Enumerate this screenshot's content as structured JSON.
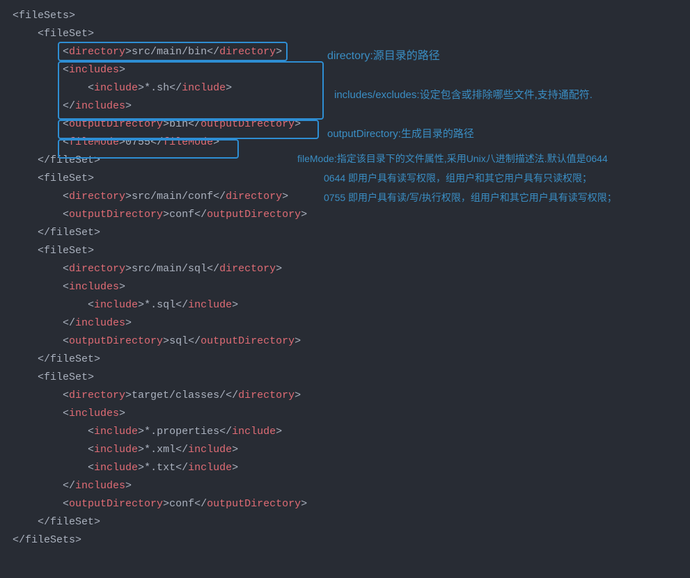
{
  "code": {
    "l1": "<fileSets>",
    "l2": "    <fileSet>",
    "l3a": "        <",
    "l3t1": "directory",
    "l3b": ">",
    "l3txt": "src/main/bin",
    "l3c": "</",
    "l3t2": "directory",
    "l3d": ">",
    "l4a": "        <",
    "l4t1": "includes",
    "l4b": ">",
    "l5a": "            <",
    "l5t1": "include",
    "l5b": ">",
    "l5txt": "*.sh",
    "l5c": "</",
    "l5t2": "include",
    "l5d": ">",
    "l6a": "        </",
    "l6t1": "includes",
    "l6b": ">",
    "l7a": "        <",
    "l7t1": "outputDirectory",
    "l7b": ">",
    "l7txt": "bin",
    "l7c": "</",
    "l7t2": "outputDirectory",
    "l7d": ">",
    "l8a": "        <",
    "l8t1": "fileMode",
    "l8b": ">",
    "l8txt": "0755",
    "l8c": "</",
    "l8t2": "fileMode",
    "l8d": ">",
    "l9": "    </fileSet>",
    "l10": "    <fileSet>",
    "l11a": "        <",
    "l11t1": "directory",
    "l11b": ">",
    "l11txt": "src/main/conf",
    "l11c": "</",
    "l11t2": "directory",
    "l11d": ">",
    "l12a": "        <",
    "l12t1": "outputDirectory",
    "l12b": ">",
    "l12txt": "conf",
    "l12c": "</",
    "l12t2": "outputDirectory",
    "l12d": ">",
    "l13": "    </fileSet>",
    "l14": "    <fileSet>",
    "l15a": "        <",
    "l15t1": "directory",
    "l15b": ">",
    "l15txt": "src/main/sql",
    "l15c": "</",
    "l15t2": "directory",
    "l15d": ">",
    "l16a": "        <",
    "l16t1": "includes",
    "l16b": ">",
    "l17a": "            <",
    "l17t1": "include",
    "l17b": ">",
    "l17txt": "*.sql",
    "l17c": "</",
    "l17t2": "include",
    "l17d": ">",
    "l18a": "        </",
    "l18t1": "includes",
    "l18b": ">",
    "l19a": "        <",
    "l19t1": "outputDirectory",
    "l19b": ">",
    "l19txt": "sql",
    "l19c": "</",
    "l19t2": "outputDirectory",
    "l19d": ">",
    "l20": "    </fileSet>",
    "l21": "    <fileSet>",
    "l22a": "        <",
    "l22t1": "directory",
    "l22b": ">",
    "l22txt": "target/classes/",
    "l22c": "</",
    "l22t2": "directory",
    "l22d": ">",
    "l23a": "        <",
    "l23t1": "includes",
    "l23b": ">",
    "l24a": "            <",
    "l24t1": "include",
    "l24b": ">",
    "l24txt": "*.properties",
    "l24c": "</",
    "l24t2": "include",
    "l24d": ">",
    "l25a": "            <",
    "l25t1": "include",
    "l25b": ">",
    "l25txt": "*.xml",
    "l25c": "</",
    "l25t2": "include",
    "l25d": ">",
    "l26a": "            <",
    "l26t1": "include",
    "l26b": ">",
    "l26txt": "*.txt",
    "l26c": "</",
    "l26t2": "include",
    "l26d": ">",
    "l27a": "        </",
    "l27t1": "includes",
    "l27b": ">",
    "l28a": "        <",
    "l28t1": "outputDirectory",
    "l28b": ">",
    "l28txt": "conf",
    "l28c": "</",
    "l28t2": "outputDirectory",
    "l28d": ">",
    "l29": "    </fileSet>",
    "l30": "</fileSets>"
  },
  "annotations": {
    "a1": "directory:源目录的路径",
    "a2": "includes/excludes:设定包含或排除哪些文件,支持通配符.",
    "a3": "outputDirectory:生成目录的路径",
    "a4": "fileMode:指定该目录下的文件属性,采用Unix八进制描述法.默认值是0644",
    "a5": "0644 即用户具有读写权限，组用户和其它用户具有只读权限；",
    "a6": "0755 即用户具有读/写/执行权限，组用户和其它用户具有读写权限；"
  }
}
